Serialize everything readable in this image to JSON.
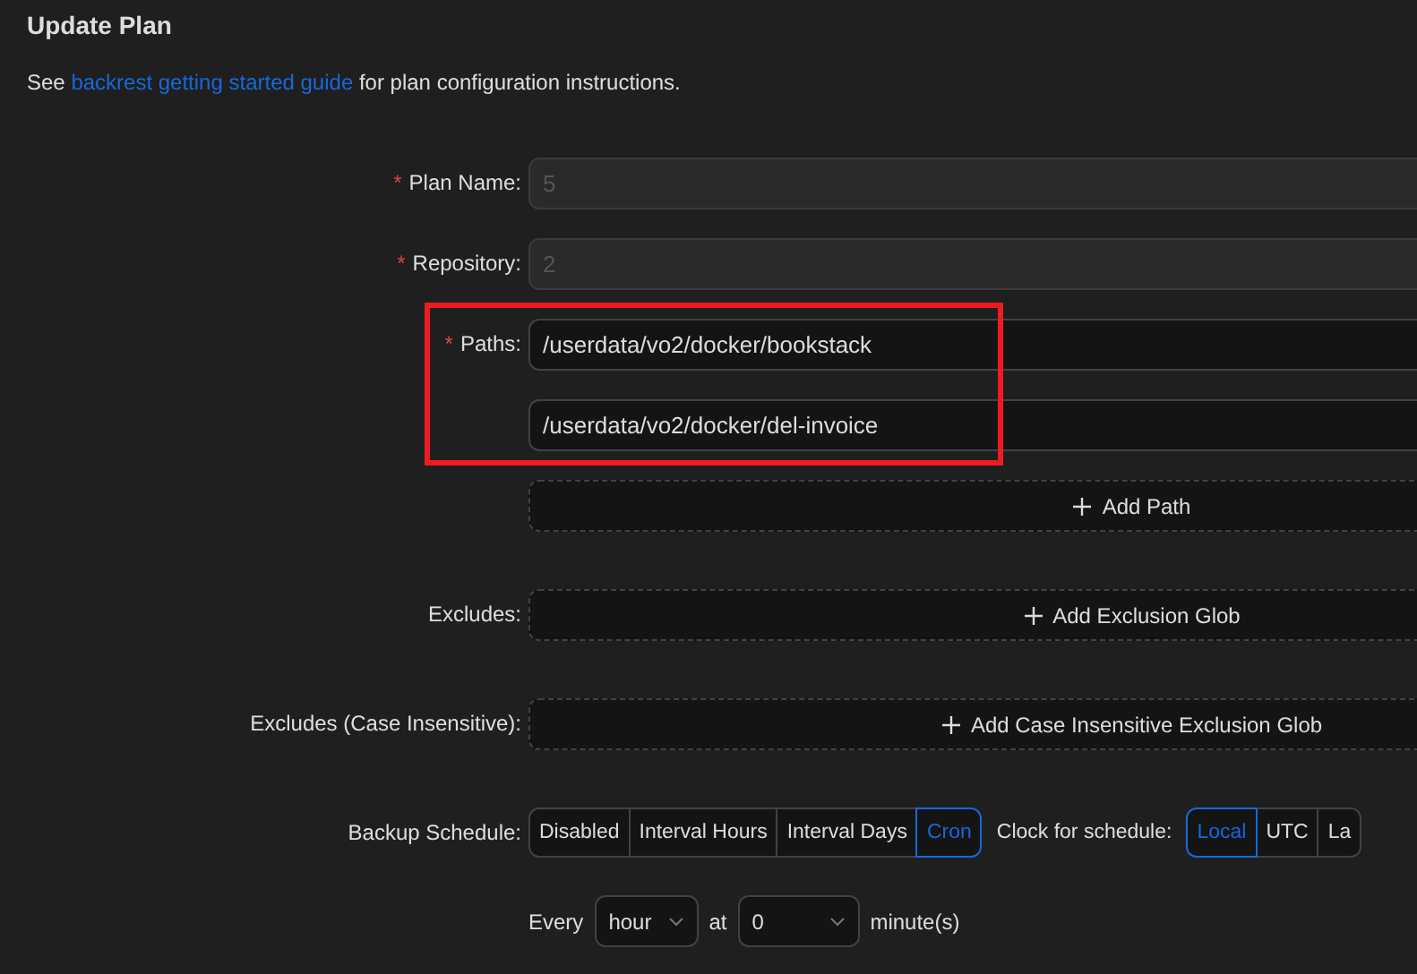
{
  "title": "Update Plan",
  "intro": {
    "before": "See ",
    "link": "backrest getting started guide",
    "after": " for plan configuration instructions."
  },
  "fields": [
    {
      "kind": "input",
      "marker": "*",
      "label": "Plan Name:",
      "value": "5",
      "disabled": true
    },
    {
      "kind": "input",
      "marker": "*",
      "label": "Repository:",
      "value": "2",
      "disabled": true
    },
    {
      "kind": "list",
      "marker": "*",
      "label": "Paths:",
      "values": [
        "/userdata/vo2/docker/bookstack",
        "/userdata/vo2/docker/del-invoice"
      ],
      "add": "Add Path"
    },
    {
      "kind": "list",
      "label": "Excludes:",
      "add": "Add Exclusion Glob"
    },
    {
      "kind": "list",
      "label": "Excludes (Case Insensitive):",
      "add": "Add Case Insensitive Exclusion Glob"
    }
  ],
  "schedule": {
    "label": "Backup Schedule:",
    "options": [
      {
        "label": "Disabled",
        "selected": false
      },
      {
        "label": "Interval Hours",
        "selected": false
      },
      {
        "label": "Interval Days",
        "selected": false
      },
      {
        "label": "Cron",
        "selected": true
      }
    ],
    "clock_label": "Clock for schedule:",
    "clock_options": [
      {
        "label": "Local",
        "selected": true
      },
      {
        "label": "UTC",
        "selected": false
      },
      {
        "label": "La",
        "selected": false
      }
    ]
  },
  "cron": {
    "every": "Every",
    "unit": "hour",
    "at": "at",
    "minute": "0",
    "suffix": "minute(s)"
  }
}
